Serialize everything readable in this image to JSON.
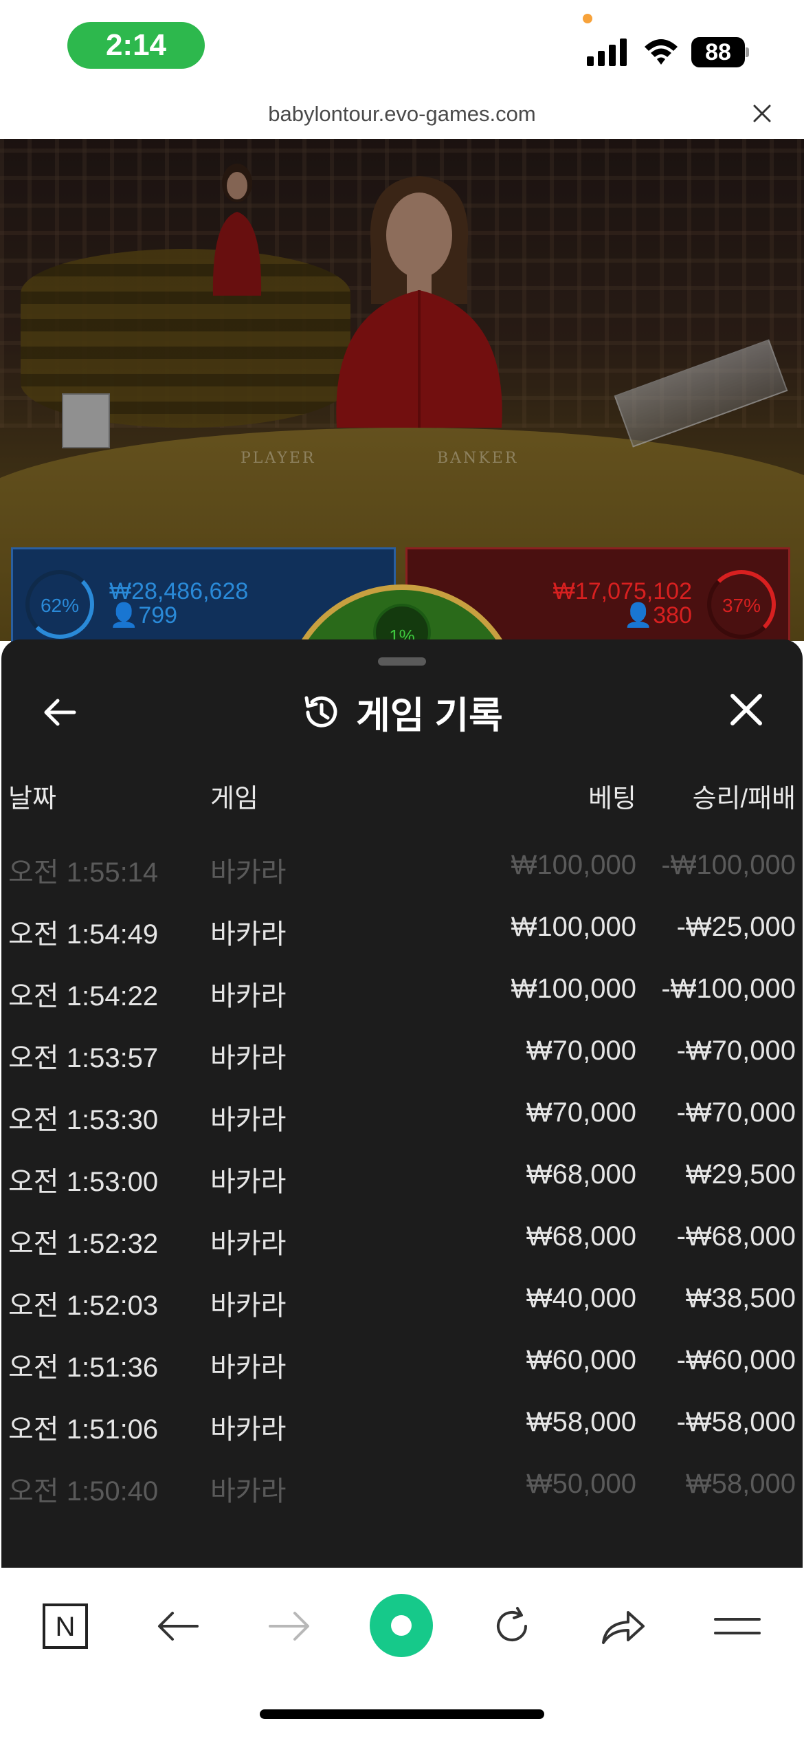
{
  "status_bar": {
    "time": "2:14",
    "battery": "88"
  },
  "browser": {
    "url": "babylontour.evo-games.com"
  },
  "video": {
    "player_label": "PLAYER",
    "banker_label": "BANKER"
  },
  "bets": {
    "player": {
      "percent": "62%",
      "amount": "₩28,486,628",
      "count": "799",
      "color": "#2a8ad8"
    },
    "banker": {
      "percent": "37%",
      "amount": "₩17,075,102",
      "count": "380",
      "color": "#d82020"
    },
    "tie": {
      "percent": "1%"
    }
  },
  "history": {
    "title": "게임 기록",
    "columns": {
      "date": "날짜",
      "game": "게임",
      "bet": "베팅",
      "result": "승리/패배"
    },
    "rows": [
      {
        "date": "오전 1:55:14",
        "game": "바카라",
        "bet": "₩100,000",
        "result": "-₩100,000"
      },
      {
        "date": "오전 1:54:49",
        "game": "바카라",
        "bet": "₩100,000",
        "result": "-₩25,000"
      },
      {
        "date": "오전 1:54:22",
        "game": "바카라",
        "bet": "₩100,000",
        "result": "-₩100,000"
      },
      {
        "date": "오전 1:53:57",
        "game": "바카라",
        "bet": "₩70,000",
        "result": "-₩70,000"
      },
      {
        "date": "오전 1:53:30",
        "game": "바카라",
        "bet": "₩70,000",
        "result": "-₩70,000"
      },
      {
        "date": "오전 1:53:00",
        "game": "바카라",
        "bet": "₩68,000",
        "result": "₩29,500"
      },
      {
        "date": "오전 1:52:32",
        "game": "바카라",
        "bet": "₩68,000",
        "result": "-₩68,000"
      },
      {
        "date": "오전 1:52:03",
        "game": "바카라",
        "bet": "₩40,000",
        "result": "₩38,500"
      },
      {
        "date": "오전 1:51:36",
        "game": "바카라",
        "bet": "₩60,000",
        "result": "-₩60,000"
      },
      {
        "date": "오전 1:51:06",
        "game": "바카라",
        "bet": "₩58,000",
        "result": "-₩58,000"
      },
      {
        "date": "오전 1:50:40",
        "game": "바카라",
        "bet": "₩50,000",
        "result": "₩58,000"
      }
    ]
  },
  "toolbar": {
    "n_label": "N",
    "accent": "#16c98a"
  }
}
